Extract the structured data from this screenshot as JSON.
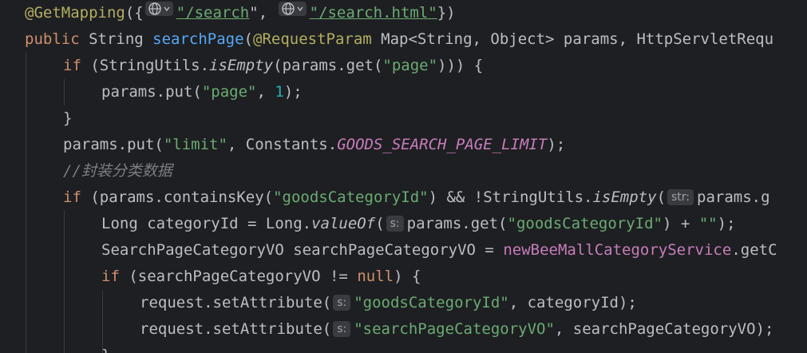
{
  "editor": {
    "l1": {
      "ann": "@GetMapping",
      "p1": "({",
      "sep": "\", ",
      "path1": "\"/search",
      "path2": "\"/search.html\"",
      "p2": "})"
    },
    "l2": {
      "kw": "public",
      "type": " String ",
      "name": "searchPage",
      "p1": "(",
      "ann": "@RequestParam",
      "rest": " Map<String, Object> params, HttpServletRequ"
    },
    "l3": {
      "kw": "if",
      "p1": " (StringUtils.",
      "m": "isEmpty",
      "p2": "(params.get(",
      "s": "\"page\"",
      "p3": "))) {"
    },
    "l4": {
      "p1": "params.put(",
      "s": "\"page\"",
      "p2": ", ",
      "n": "1",
      "p3": ");"
    },
    "l5": {
      "p1": "}"
    },
    "l6": {
      "p1": "params.put(",
      "s": "\"limit\"",
      "p2": ", Constants.",
      "c": "GOODS_SEARCH_PAGE_LIMIT",
      "p3": ");"
    },
    "l7": {
      "comment": "//封装分类数据"
    },
    "l8": {
      "kw": "if",
      "p1": " (params.containsKey(",
      "s": "\"goodsCategoryId\"",
      "p2": ") && !StringUtils.",
      "m": "isEmpty",
      "p3": "(",
      "hint": "str:",
      "p4": "params.g"
    },
    "l9": {
      "p1": "Long categoryId = Long.",
      "m": "valueOf",
      "p2": "(",
      "hint": "s:",
      "p3": "params.get(",
      "s": "\"goodsCategoryId\"",
      "p4": ") + ",
      "s2": "\"\"",
      "p5": ");"
    },
    "l10": {
      "p1": "SearchPageCategoryVO searchPageCategoryVO = ",
      "f": "newBeeMallCategoryService",
      "p2": ".getC"
    },
    "l11": {
      "kw": "if",
      "p1": " (searchPageCategoryVO != ",
      "kw2": "null",
      "p2": ") {"
    },
    "l12": {
      "p1": "request.setAttribute(",
      "hint": "s:",
      "s": "\"goodsCategoryId\"",
      "p2": ", categoryId);"
    },
    "l13": {
      "p1": "request.setAttribute(",
      "hint": "s:",
      "s": "\"searchPageCategoryVO\"",
      "p2": ", searchPageCategoryVO);"
    },
    "l14": {
      "p1": "}"
    }
  },
  "icons": {
    "hint_icon": "globe-icon",
    "dropdown": "chevron-down-icon"
  }
}
